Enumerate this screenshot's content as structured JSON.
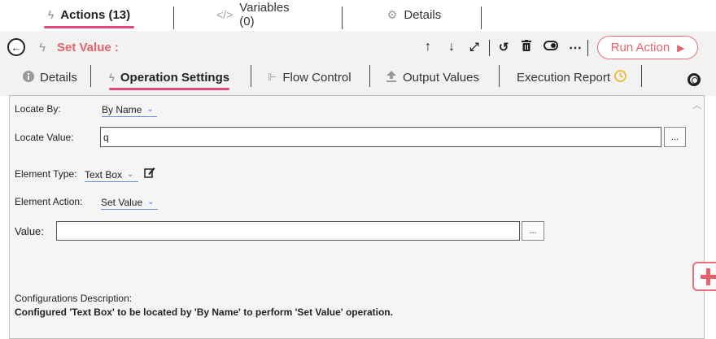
{
  "top_tabs": {
    "actions": "Actions (13)",
    "variables": "Variables (0)",
    "details": "Details"
  },
  "action": {
    "title": "Set Value :",
    "run_label": "Run Action",
    "run_arrow": "▶"
  },
  "toolbar_icons": [
    "move-up-icon",
    "move-down-icon",
    "expand-icon",
    "undo-icon",
    "delete-icon",
    "toggle-icon",
    "more-icon"
  ],
  "sub_tabs": {
    "details": "Details",
    "operation_settings": "Operation Settings",
    "flow_control": "Flow Control",
    "output_values": "Output Values",
    "execution_report": "Execution Report"
  },
  "form": {
    "locate_by_label": "Locate By:",
    "locate_by_value": "By Name",
    "locate_value_label": "Locate Value:",
    "locate_value": "q",
    "element_type_label": "Element Type:",
    "element_type_value": "Text Box",
    "element_action_label": "Element Action:",
    "element_action_value": "Set Value",
    "value_label": "Value:",
    "value": "",
    "browse_label": "...",
    "config_desc_label": "Configurations Description:",
    "config_desc": "Configured 'Text Box' to be located by 'By Name' to perform 'Set Value' operation."
  },
  "colors": {
    "accent": "#e0457b",
    "run_text": "#e8606a",
    "dropdown_chevron": "#3b7ad8",
    "report_clock": "#f0b429"
  }
}
